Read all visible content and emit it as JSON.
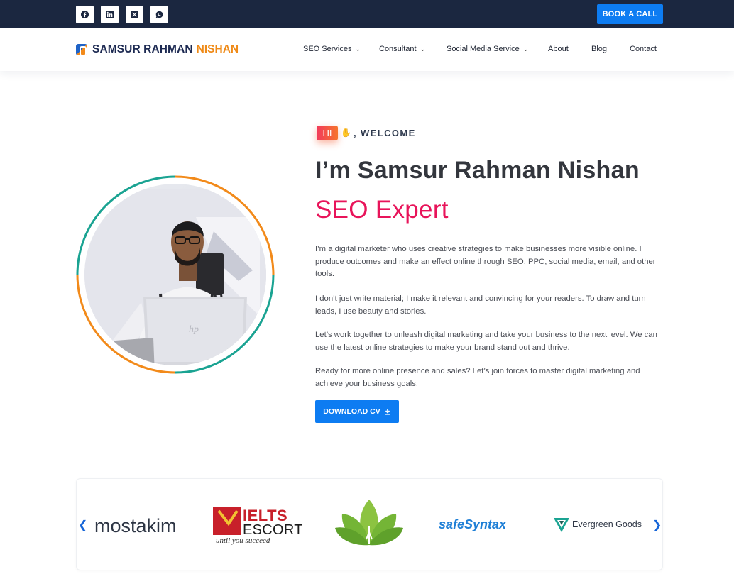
{
  "topbar": {
    "social": [
      {
        "name": "facebook-icon",
        "glyph": "f"
      },
      {
        "name": "linkedin-icon",
        "glyph": "in"
      },
      {
        "name": "x-icon",
        "glyph": "X"
      },
      {
        "name": "whatsapp-icon",
        "glyph": "w"
      }
    ],
    "book_label": "BOOK A CALL",
    "background": "#1b2740",
    "accent": "#0d7cf2"
  },
  "nav": {
    "logo_first": "SAMSUR RAHMAN",
    "logo_second": "NISHAN",
    "items": [
      {
        "label": "SEO Services",
        "dropdown": true
      },
      {
        "label": "Consultant",
        "dropdown": true
      },
      {
        "label": "Social Media Service",
        "dropdown": true
      },
      {
        "label": "About",
        "dropdown": false
      },
      {
        "label": "Blog",
        "dropdown": false
      },
      {
        "label": "Contact",
        "dropdown": false
      }
    ]
  },
  "hero": {
    "hi": "HI",
    "welcome": ", WELCOME",
    "title": "I’m Samsur Rahman Nishan",
    "subtitle": "SEO Expert",
    "paragraphs": [
      "I’m a digital marketer who uses creative strategies to make businesses more visible online. I produce outcomes and make an effect online through SEO, PPC, social media, email, and other tools.",
      "I don’t just write material; I make it relevant and convincing for your readers. To draw and turn leads, I use beauty and stories.",
      "Let’s work together to unleash digital marketing and take your business to the next level. We can use the latest online strategies to make your brand stand out and thrive.",
      "Ready for more online presence and sales? Let’s join forces to master digital marketing and achieve your business goals."
    ],
    "download_label": "DOWNLOAD CV",
    "highlight_color": "#e8145a"
  },
  "brands": {
    "logos": [
      {
        "text": "mostakim"
      },
      {
        "line1": "IELTS",
        "line2": "ESCORT",
        "tagline": "until you succeed"
      },
      {
        "text": "lotus-logo"
      },
      {
        "text": "safeSyntax"
      },
      {
        "text": "Evergreen Goods"
      }
    ]
  }
}
